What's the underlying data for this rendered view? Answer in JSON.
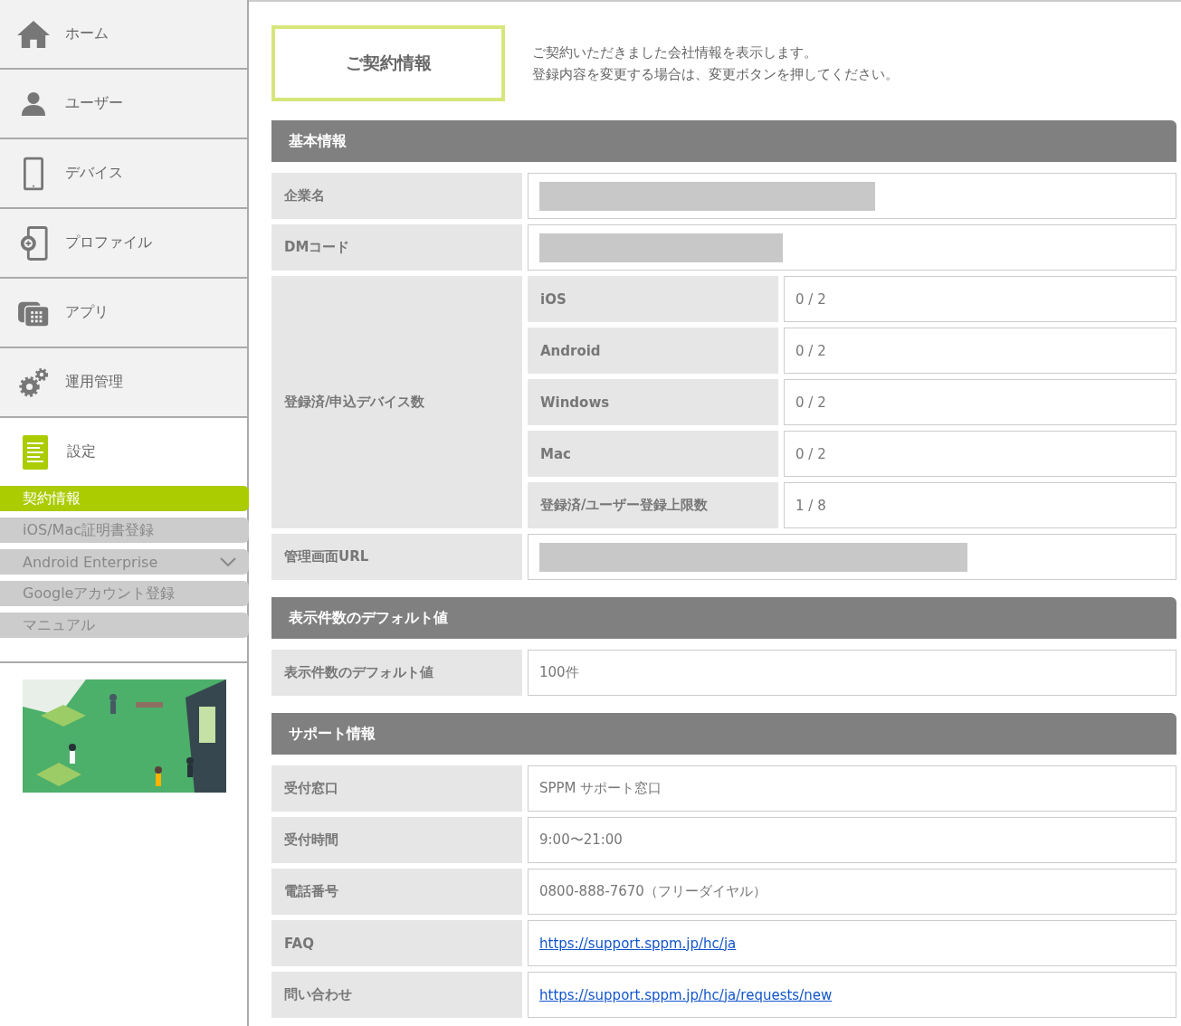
{
  "sidebar": {
    "items": [
      {
        "label": "ホーム",
        "selected": false
      },
      {
        "label": "ユーザー",
        "selected": false
      },
      {
        "label": "デバイス",
        "selected": false
      },
      {
        "label": "プロファイル",
        "selected": false
      },
      {
        "label": "アプリ",
        "selected": false
      },
      {
        "label": "運用管理",
        "selected": false
      },
      {
        "label": "設定",
        "selected": true
      }
    ],
    "submenu": [
      {
        "label": "契約情報",
        "selected": true,
        "expandable": false
      },
      {
        "label": "iOS/Mac証明書登録",
        "selected": false,
        "expandable": false
      },
      {
        "label": "Android Enterprise",
        "selected": false,
        "expandable": true
      },
      {
        "label": "Googleアカウント登録",
        "selected": false,
        "expandable": false
      },
      {
        "label": "マニュアル",
        "selected": false,
        "expandable": false
      }
    ]
  },
  "main": {
    "title": "ご契約情報",
    "description": [
      "ご契約いただきました会社情報を表示します。",
      "登録内容を変更する場合は、変更ボタンを押してください。"
    ],
    "sections": [
      {
        "title": "基本情報",
        "rows": [
          {
            "kind": "masked",
            "label": "企業名"
          },
          {
            "kind": "masked",
            "label": "DMコード"
          },
          {
            "kind": "group",
            "label": "登録済/申込デバイス数",
            "items": [
              {
                "label": "iOS",
                "value": "0 / 2"
              },
              {
                "label": "Android",
                "value": "0 / 2"
              },
              {
                "label": "Windows",
                "value": "0 / 2"
              },
              {
                "label": "Mac",
                "value": "0 / 2"
              },
              {
                "label": "登録済/ユーザー登録上限数",
                "value": "1 / 8"
              }
            ]
          },
          {
            "kind": "masked",
            "label": "管理画面URL"
          }
        ]
      },
      {
        "title": "表示件数のデフォルト値",
        "rows": [
          {
            "kind": "text",
            "label": "表示件数のデフォルト値",
            "value": "100件"
          }
        ]
      },
      {
        "title": "サポート情報",
        "rows": [
          {
            "kind": "text",
            "label": "受付窓口",
            "value": "SPPM サポート窓口"
          },
          {
            "kind": "text",
            "label": "受付時間",
            "value": "9:00〜21:00"
          },
          {
            "kind": "text",
            "label": "電話番号",
            "value": "0800-888-7670（フリーダイヤル）"
          },
          {
            "kind": "link",
            "label": "FAQ",
            "value": "https://support.sppm.jp/hc/ja"
          },
          {
            "kind": "link",
            "label": "問い合わせ",
            "value": "https://support.sppm.jp/hc/ja/requests/new"
          }
        ]
      }
    ]
  }
}
